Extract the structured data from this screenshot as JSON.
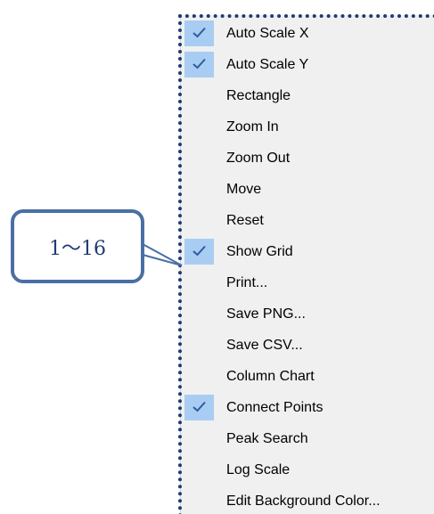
{
  "menu": {
    "items": [
      {
        "label": "Auto Scale X",
        "checked": true
      },
      {
        "label": "Auto Scale Y",
        "checked": true
      },
      {
        "label": "Rectangle",
        "checked": false
      },
      {
        "label": "Zoom In",
        "checked": false
      },
      {
        "label": "Zoom Out",
        "checked": false
      },
      {
        "label": "Move",
        "checked": false
      },
      {
        "label": "Reset",
        "checked": false
      },
      {
        "label": "Show Grid",
        "checked": true
      },
      {
        "label": "Print...",
        "checked": false
      },
      {
        "label": "Save PNG...",
        "checked": false
      },
      {
        "label": "Save CSV...",
        "checked": false
      },
      {
        "label": "Column Chart",
        "checked": false
      },
      {
        "label": "Connect Points",
        "checked": true
      },
      {
        "label": "Peak Search",
        "checked": false
      },
      {
        "label": "Log Scale",
        "checked": false
      },
      {
        "label": "Edit Background Color...",
        "checked": false
      }
    ],
    "check_icon": "checkmark-icon"
  },
  "callout": {
    "label": "1～16"
  },
  "colors": {
    "menu_bg": "#f0f0f0",
    "check_highlight": "#a9cdf2",
    "check_mark": "#2b5d9e",
    "annotation": "#1f3b73",
    "callout_border": "#4a6fa5"
  }
}
